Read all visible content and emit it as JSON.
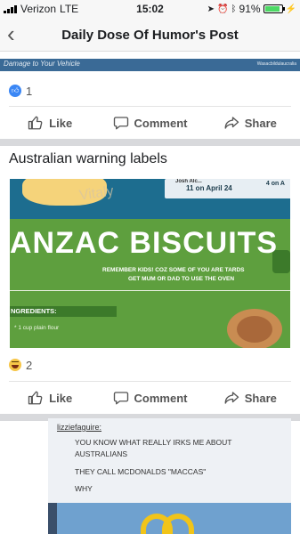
{
  "status_bar": {
    "carrier": "Verizon",
    "network": "LTE",
    "time": "15:02",
    "battery_percent": "91%",
    "battery_level": 0.91
  },
  "nav": {
    "back_icon": "chevron-left-icon",
    "title": "Daily Dose Of Humor's Post"
  },
  "post1": {
    "image_caption_left": "Damage to Your Vehicle",
    "image_caption_right": "Wasacbildulaucralia",
    "reaction_count": "1",
    "actions": {
      "like": "Like",
      "comment": "Comment",
      "share": "Share"
    }
  },
  "post2": {
    "text": "Australian warning labels",
    "image": {
      "brand": "Vitaly",
      "card_name": "Josh Alc...",
      "card_date": "11 on April 24",
      "card_right": "4 on A",
      "headline": "ANZAC BISCUITS",
      "line1": "REMEMBER KIDS! COZ SOME OF YOU ARE TARDS",
      "line2": "GET MUM OR DAD TO USE THE OVEN",
      "ingredients_label": "NGREDIENTS:",
      "ingredient1": "* 1 cup plain flour"
    },
    "reaction_count": "2",
    "actions": {
      "like": "Like",
      "comment": "Comment",
      "share": "Share"
    }
  },
  "post3": {
    "image": {
      "username": "lizziefaguire:",
      "line1": "YOU KNOW WHAT REALLY IRKS ME ABOUT",
      "line2": "AUSTRALIANS",
      "line3": "THEY CALL MCDONALDS \"MACCAS\"",
      "line4": "WHY"
    }
  },
  "colors": {
    "like_blue": "#3b87f5",
    "divider": "#e4e4e4",
    "feed_gap": "#d8d9dc",
    "battery_green": "#4cd964"
  }
}
